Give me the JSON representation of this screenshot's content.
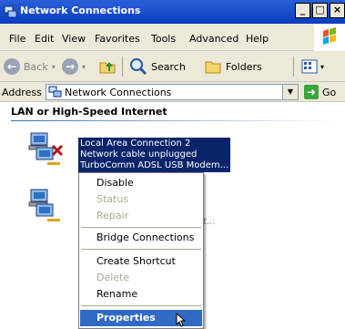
{
  "window": {
    "title": "Network Connections",
    "buttons": [
      "_",
      "□",
      "×"
    ]
  },
  "menu": [
    "File",
    "Edit",
    "View",
    "Favorites",
    "Tools",
    "Advanced",
    "Help"
  ],
  "toolbar": {
    "back": "Back",
    "search": "Search",
    "folders": "Folders"
  },
  "address": {
    "label": "Address",
    "value": "Network Connections",
    "go": "Go"
  },
  "group": {
    "header": "LAN or High-Speed Internet"
  },
  "connections": [
    {
      "name": "Local Area Connection 2",
      "status": "Network cable unplugged",
      "device": "TurboComm ADSL USB Modem..."
    },
    {
      "partial_text": "t..."
    }
  ],
  "context_menu": {
    "items": [
      {
        "label": "Disable",
        "enabled": true
      },
      {
        "label": "Status",
        "enabled": false
      },
      {
        "label": "Repair",
        "enabled": false
      },
      {
        "label": "Bridge Connections",
        "enabled": true
      },
      {
        "label": "Create Shortcut",
        "enabled": true
      },
      {
        "label": "Delete",
        "enabled": false
      },
      {
        "label": "Rename",
        "enabled": true
      },
      {
        "label": "Properties",
        "enabled": true,
        "highlighted": true
      }
    ]
  },
  "colors": {
    "titlebar": "#0a3cc0",
    "selection": "#0a246a",
    "menu_highlight": "#316ac5",
    "chrome": "#ece9d8",
    "disabled_text": "#aca899"
  }
}
